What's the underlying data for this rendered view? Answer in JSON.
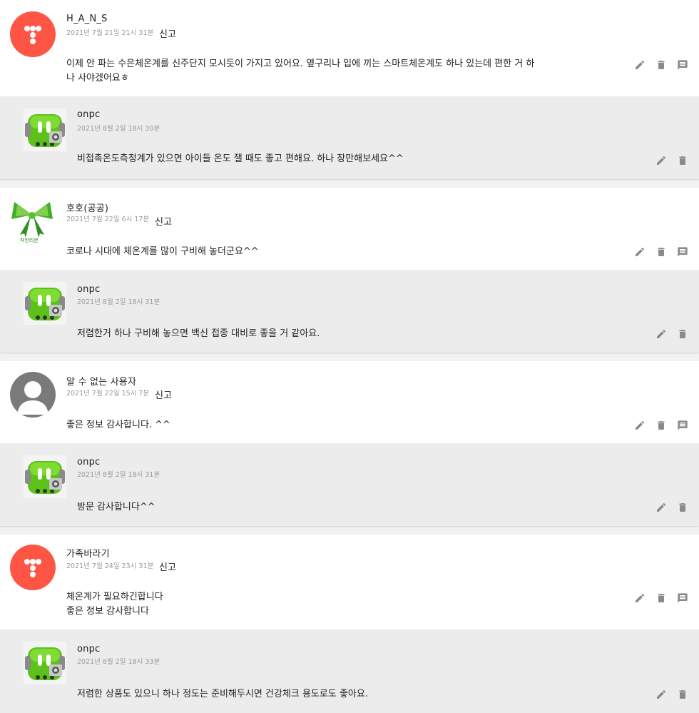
{
  "threads": [
    {
      "comment": {
        "author": "H_A_N_S",
        "date": "2021년 7월 21일 21시 31분",
        "report_label": "신고",
        "body_lines": [
          "이제 안 파는 수은체온계를 신주단지 모시듯이 가지고 있어요. 옆구리나 입에 끼는 스마트체온계도 하나 있는데 편한 거 하",
          "나 사야겠어요ㅎ"
        ],
        "avatar": "tistory-logo-avatar"
      },
      "reply": {
        "author": "onpc",
        "date": "2021년 8월 2일 18시 30분",
        "body": "비접촉온도측정계가 있으면 아이들 온도 잴 때도 좋고 편해요. 하나 장만해보세요^^",
        "avatar": "green-robot-avatar"
      }
    },
    {
      "comment": {
        "author": "호호(공공)",
        "date": "2021년 7월 22일 6시 17분",
        "report_label": "신고",
        "body_lines": [
          "코로나 시대에 체온계를 많이 구비해 놓더군요^^"
        ],
        "avatar": "green-ribbon-avatar",
        "avatar_caption": "착한리본"
      },
      "reply": {
        "author": "onpc",
        "date": "2021년 8월 2일 18시 31분",
        "body": "저렴한거 하나 구비해 놓으면 백신 접종 대비로 좋을 거 같아요.",
        "avatar": "green-robot-avatar"
      }
    },
    {
      "comment": {
        "author": "알 수 없는 사용자",
        "date": "2021년 7월 22일 15시 7분",
        "report_label": "신고",
        "body_lines": [
          "좋은 정보 감사합니다. ^^"
        ],
        "avatar": "default-user-avatar"
      },
      "reply": {
        "author": "onpc",
        "date": "2021년 8월 2일 18시 31분",
        "body": "방문 감사합니다^^",
        "avatar": "green-robot-avatar"
      }
    },
    {
      "comment": {
        "author": "가족바라기",
        "date": "2021년 7월 24일 23시 31분",
        "report_label": "신고",
        "body_lines": [
          "체온계가 필요하긴합니다",
          "좋은 정보 감사합니다"
        ],
        "avatar": "tistory-logo-avatar"
      },
      "reply": {
        "author": "onpc",
        "date": "2021년 8월 2일 18시 33분",
        "body": "저렴한 상품도 있으니 하나 정도는 준비해두시면 건강체크 용도로도 좋아요.",
        "avatar": "green-robot-avatar"
      }
    }
  ],
  "icons": {
    "edit": "pencil-icon",
    "delete": "trash-icon",
    "reply": "comment-icon"
  },
  "colors": {
    "tistory_red": "#ff5544",
    "reply_bg": "#ececec",
    "icon_gray": "#8a8a8a"
  }
}
